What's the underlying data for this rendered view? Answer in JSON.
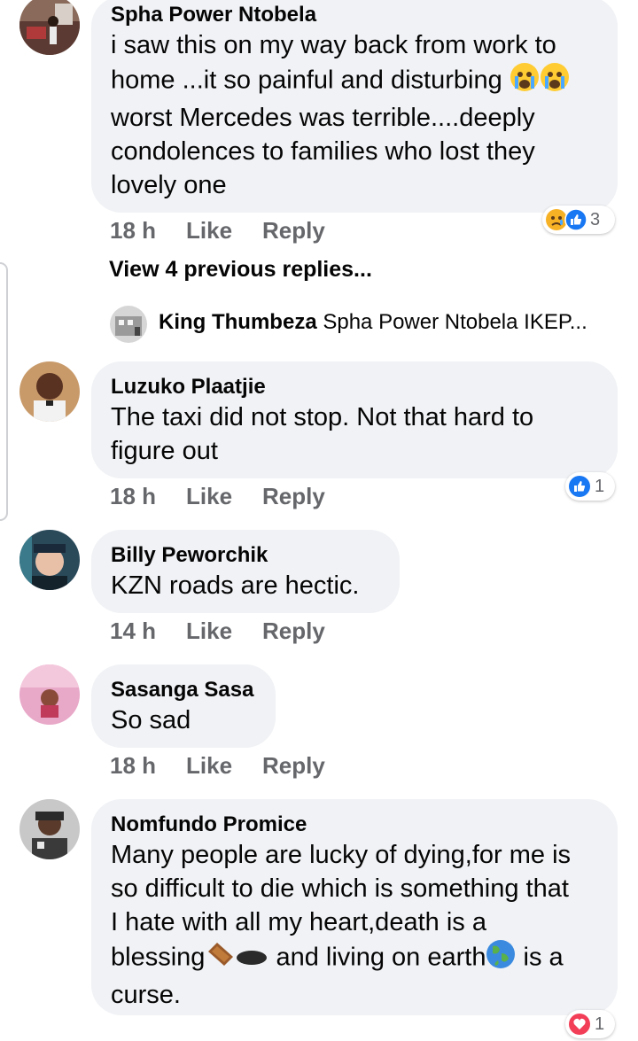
{
  "comments": [
    {
      "author": "Spha Power Ntobela",
      "text_lines": [
        "i saw this on my way back from work to",
        "home ...it so painful and disturbing",
        "worst Mercedes was terrible....deeply",
        "condolences to families who lost they",
        "lovely one"
      ],
      "time": "18 h",
      "like": "Like",
      "reply": "Reply",
      "reaction_count": "3",
      "reaction_icons": [
        "sad-icon",
        "like-icon"
      ]
    },
    {
      "author": "Luzuko Plaatjie",
      "text_lines": [
        "The taxi did not stop. Not that hard to",
        "figure out"
      ],
      "time": "18 h",
      "like": "Like",
      "reply": "Reply",
      "reaction_count": "1",
      "reaction_icons": [
        "like-icon"
      ]
    },
    {
      "author": "Billy Peworchik",
      "text_lines": [
        "KZN roads are hectic."
      ],
      "time": "14 h",
      "like": "Like",
      "reply": "Reply"
    },
    {
      "author": "Sasanga Sasa",
      "text_lines": [
        "So sad"
      ],
      "time": "18 h",
      "like": "Like",
      "reply": "Reply"
    },
    {
      "author": "Nomfundo Promice",
      "text_lines": [
        "Many people are lucky of dying,for me is",
        "so difficult to die which is something that",
        "I hate with all my heart,death is a",
        "blessing",
        " and living on earth",
        " is a",
        "curse."
      ],
      "reaction_count": "1",
      "reaction_icons": [
        "love-icon"
      ]
    }
  ],
  "view_previous": "View 4 previous replies...",
  "reply_preview": {
    "author": "King Thumbeza",
    "text": "Spha Power Ntobela IKEP..."
  },
  "colors": {
    "bubble": "#f0f2f5",
    "meta": "#65676b",
    "like_blue": "#1877f2",
    "love_red": "#f33e58"
  }
}
